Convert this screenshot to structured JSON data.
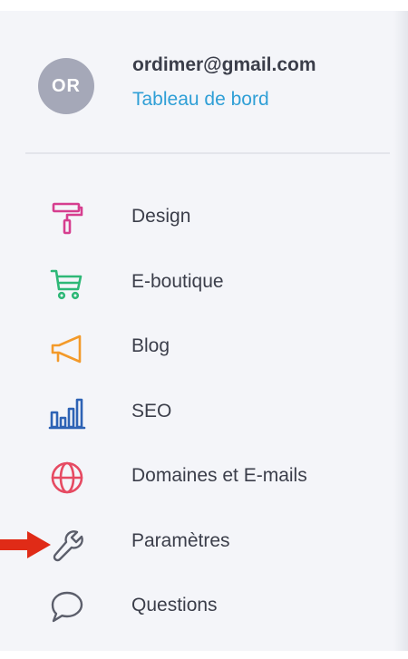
{
  "profile": {
    "avatar_initials": "OR",
    "email": "ordimer@gmail.com",
    "dashboard_link": "Tableau de bord"
  },
  "menu": {
    "items": [
      {
        "label": "Design",
        "icon": "paint-roller-icon",
        "color": "#d63e8f"
      },
      {
        "label": "E-boutique",
        "icon": "shopping-cart-icon",
        "color": "#2eb877"
      },
      {
        "label": "Blog",
        "icon": "megaphone-icon",
        "color": "#f39a2a"
      },
      {
        "label": "SEO",
        "icon": "bar-chart-icon",
        "color": "#2e63b5"
      },
      {
        "label": "Domaines et E-mails",
        "icon": "globe-icon",
        "color": "#e64a62"
      },
      {
        "label": "Paramètres",
        "icon": "wrench-icon",
        "color": "#5b5e6b"
      },
      {
        "label": "Questions",
        "icon": "speech-bubble-icon",
        "color": "#5b5e6b"
      }
    ]
  },
  "annotation": {
    "arrow_icon": "red-arrow-icon",
    "arrow_color": "#e02b17"
  }
}
